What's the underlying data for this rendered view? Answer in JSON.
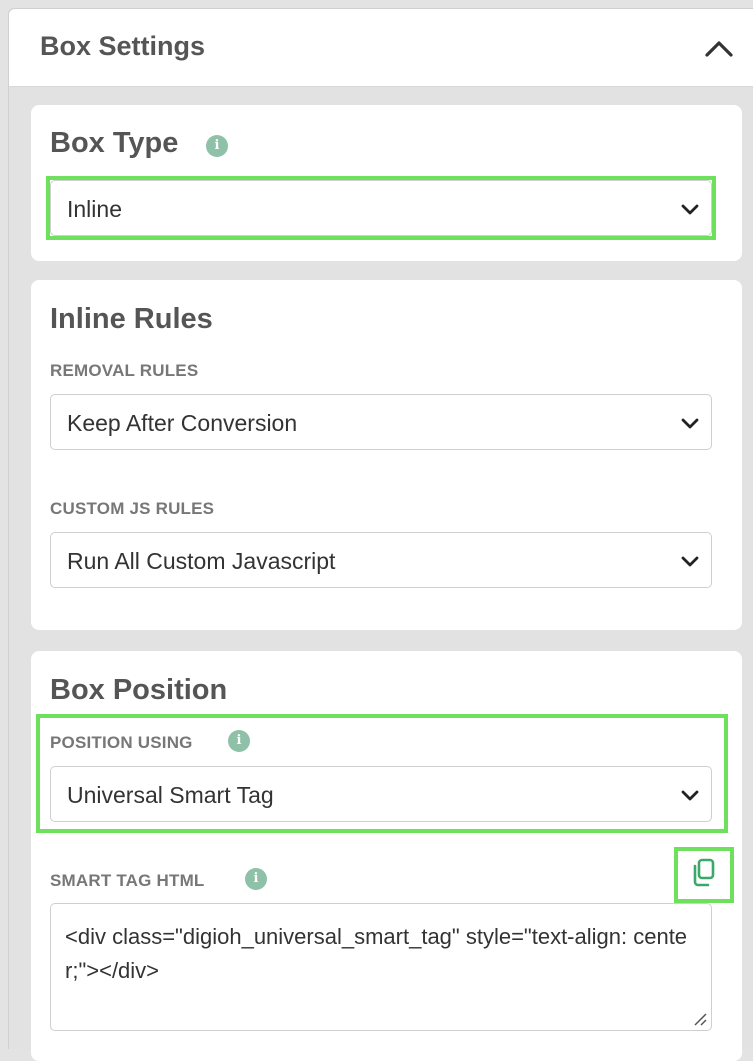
{
  "panel": {
    "title": "Box Settings",
    "collapse_icon": "chevron-up-icon"
  },
  "box_type": {
    "title": "Box Type",
    "info_icon": "i",
    "select_value": "Inline"
  },
  "inline_rules": {
    "title": "Inline Rules",
    "removal_label": "REMOVAL RULES",
    "removal_value": "Keep After Conversion",
    "custom_js_label": "CUSTOM JS RULES",
    "custom_js_value": "Run All Custom Javascript"
  },
  "box_position": {
    "title": "Box Position",
    "position_label": "POSITION USING",
    "position_info_icon": "i",
    "position_value": "Universal Smart Tag",
    "smart_tag_label": "SMART TAG HTML",
    "smart_tag_info_icon": "i",
    "smart_tag_html": "<div class=\"digioh_universal_smart_tag\" style=\"text-align: center;\"></div>",
    "copy_icon": "copy-icon"
  },
  "colors": {
    "highlight": "#6ee05e",
    "info_icon": "#8fc0a8",
    "copy_icon": "#3aa86a"
  }
}
